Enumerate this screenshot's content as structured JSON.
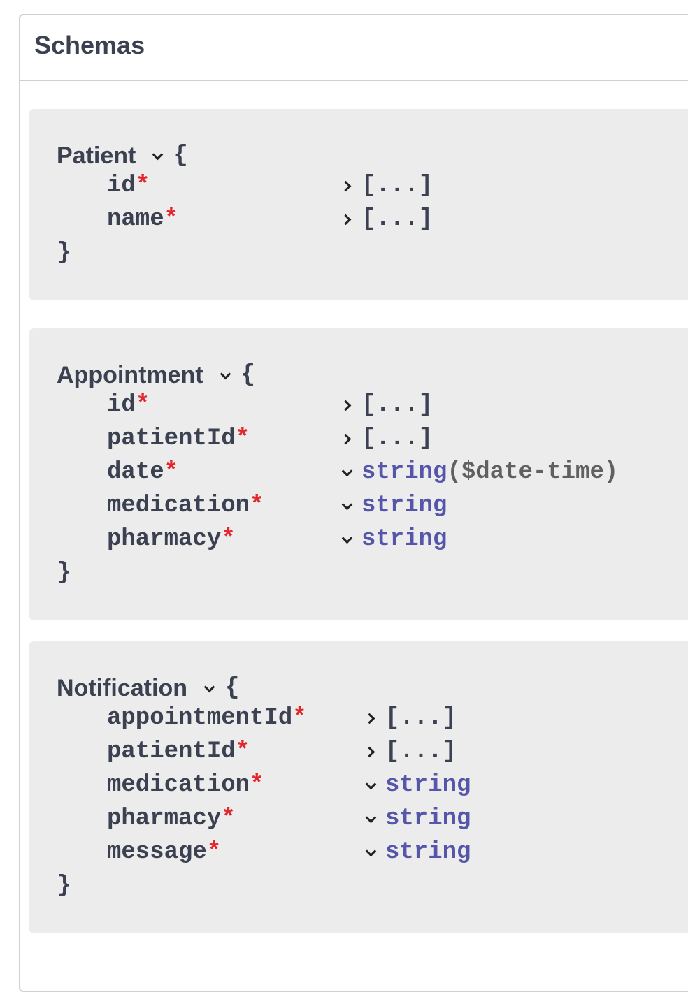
{
  "section": {
    "title": "Schemas"
  },
  "models": [
    {
      "name": "Patient",
      "open_brace": "{",
      "close_brace": "}",
      "properties": [
        {
          "name": "id",
          "required_mark": "*",
          "value": "[...]",
          "expanded": false
        },
        {
          "name": "name",
          "required_mark": "*",
          "value": "[...]",
          "expanded": false
        }
      ]
    },
    {
      "name": "Appointment",
      "open_brace": "{",
      "close_brace": "}",
      "properties": [
        {
          "name": "id",
          "required_mark": "*",
          "value": "[...]",
          "expanded": false
        },
        {
          "name": "patientId",
          "required_mark": "*",
          "value": "[...]",
          "expanded": false
        },
        {
          "name": "date",
          "required_mark": "*",
          "type": "string",
          "format": "($date-time)",
          "expanded": true
        },
        {
          "name": "medication",
          "required_mark": "*",
          "type": "string",
          "expanded": true
        },
        {
          "name": "pharmacy",
          "required_mark": "*",
          "type": "string",
          "expanded": true
        }
      ]
    },
    {
      "name": "Notification",
      "open_brace": "{",
      "close_brace": "}",
      "properties": [
        {
          "name": "appointmentId",
          "required_mark": "*",
          "value": "[...]",
          "expanded": false
        },
        {
          "name": "patientId",
          "required_mark": "*",
          "value": "[...]",
          "expanded": false
        },
        {
          "name": "medication",
          "required_mark": "*",
          "type": "string",
          "expanded": true
        },
        {
          "name": "pharmacy",
          "required_mark": "*",
          "type": "string",
          "expanded": true
        },
        {
          "name": "message",
          "required_mark": "*",
          "type": "string",
          "expanded": true
        }
      ]
    }
  ]
}
